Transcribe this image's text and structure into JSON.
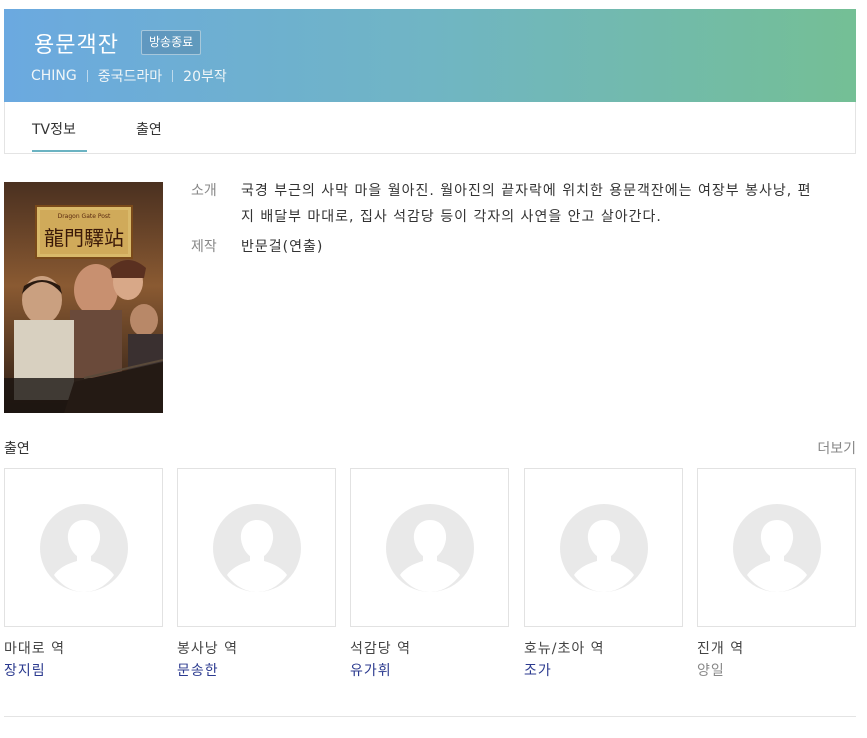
{
  "header": {
    "title": "용문객잔",
    "badge": "방송종료",
    "meta": [
      "CHING",
      "중국드라마",
      "20부작"
    ],
    "gradient_colors": [
      "#6ba9e0",
      "#74bf95"
    ]
  },
  "tabs": [
    {
      "label": "TV정보",
      "active": true
    },
    {
      "label": "출연",
      "active": false
    }
  ],
  "poster": {
    "alt": "용문객잔 포스터",
    "logo_text": "龍門驛站",
    "logo_subtitle": "Dragon Gate Post"
  },
  "info": {
    "intro_label": "소개",
    "intro_text": "국경 부근의 사막 마을 월아진. 월아진의 끝자락에 위치한 용문객잔에는 여장부 봉사낭, 편지 배달부 마대로, 집사 석감당 등이 각자의 사연을 안고 살아간다.",
    "production_label": "제작",
    "production_text": "반문걸(연출)"
  },
  "cast_section": {
    "title": "출연",
    "more_label": "더보기",
    "members": [
      {
        "role": "마대로 역",
        "actor": "장지림",
        "linked": true
      },
      {
        "role": "봉사낭 역",
        "actor": "문송한",
        "linked": true
      },
      {
        "role": "석감당 역",
        "actor": "유가휘",
        "linked": true
      },
      {
        "role": "호뉴/초아 역",
        "actor": "조가",
        "linked": true
      },
      {
        "role": "진개 역",
        "actor": "양일",
        "linked": false
      }
    ]
  }
}
